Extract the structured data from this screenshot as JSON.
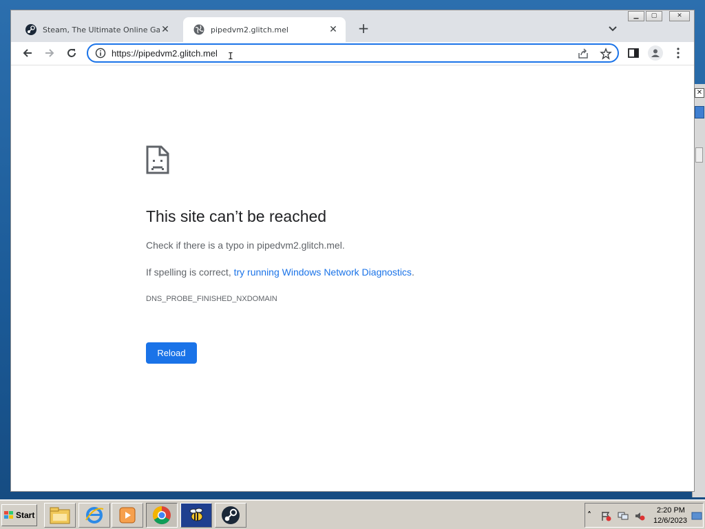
{
  "browser": {
    "tabs": [
      {
        "title": "Steam, The Ultimate Online Game P",
        "icon": "steam-icon",
        "active": false
      },
      {
        "title": "pipedvm2.glitch.mel",
        "icon": "globe-icon",
        "active": true
      }
    ],
    "new_tab_label": "+",
    "url": "https://pipedvm2.glitch.mel",
    "accent_color": "#1a73e8"
  },
  "error_page": {
    "title": "This site can’t be reached",
    "line1_prefix": "Check if there is a typo in ",
    "line1_domain": "pipedvm2.glitch.mel",
    "line1_suffix": ".",
    "line2_prefix": "If spelling is correct, ",
    "line2_link": "try running Windows Network Diagnostics",
    "line2_suffix": ".",
    "error_code": "DNS_PROBE_FINISHED_NXDOMAIN",
    "reload_label": "Reload"
  },
  "taskbar": {
    "start_label": "Start",
    "apps": [
      "file-explorer-icon",
      "internet-explorer-icon",
      "media-player-icon",
      "chrome-icon",
      "bee-app-icon",
      "steam-icon"
    ],
    "clock_time": "2:20 PM",
    "clock_date": "12/6/2023"
  }
}
